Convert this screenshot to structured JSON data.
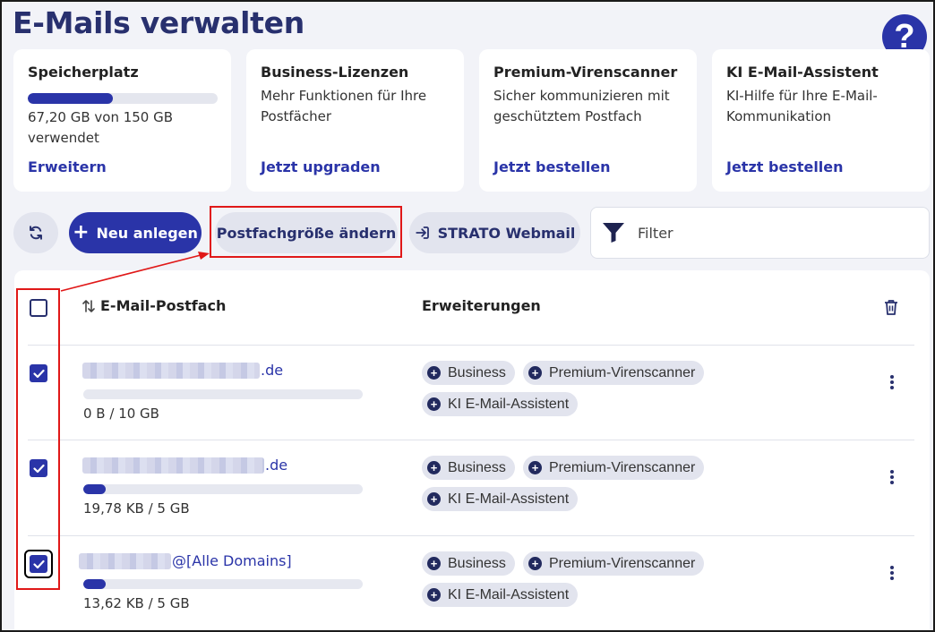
{
  "page": {
    "title": "E-Mails verwalten",
    "help_label": "?"
  },
  "cards": [
    {
      "title": "Speicherplatz",
      "text": "67,20 GB von 150 GB verwendet",
      "link": "Erweitern",
      "usage_fraction": 0.448
    },
    {
      "title": "Business-Lizenzen",
      "text": "Mehr Funktionen für Ihre Postfächer",
      "link": "Jetzt upgraden"
    },
    {
      "title": "Premium-Virenscanner",
      "text": "Sicher kommunizieren mit geschütztem Postfach",
      "link": "Jetzt bestellen"
    },
    {
      "title": "KI E-Mail-Assistent",
      "text": "KI-Hilfe für Ihre E-Mail-Kommunikation",
      "link": "Jetzt bestellen"
    }
  ],
  "toolbar": {
    "refresh_icon": "refresh-icon",
    "new_label": "Neu anlegen",
    "size_label": "Postfachgröße ändern",
    "webmail_label": "STRATO Webmail",
    "filter_placeholder": "Filter"
  },
  "table": {
    "col_mailbox": "E-Mail-Postfach",
    "col_extensions": "Erweiterungen",
    "rows": [
      {
        "suffix": ".de",
        "usage": "0 B / 10 GB",
        "fill": 0.0,
        "checked": true,
        "chips": [
          "Business",
          "Premium-Virenscanner",
          "KI E-Mail-Assistent"
        ]
      },
      {
        "suffix": ".de",
        "usage": "19,78 KB / 5 GB",
        "fill": 0.08,
        "checked": true,
        "chips": [
          "Business",
          "Premium-Virenscanner",
          "KI E-Mail-Assistent"
        ]
      },
      {
        "suffix": "@[Alle Domains]",
        "usage": "13,62 KB / 5 GB",
        "fill": 0.08,
        "checked": true,
        "chips": [
          "Business",
          "Premium-Virenscanner",
          "KI E-Mail-Assistent"
        ]
      }
    ]
  },
  "colors": {
    "primary": "#2a34a8",
    "title": "#28306e",
    "annotation": "#e01818",
    "background": "#f2f3f8"
  }
}
